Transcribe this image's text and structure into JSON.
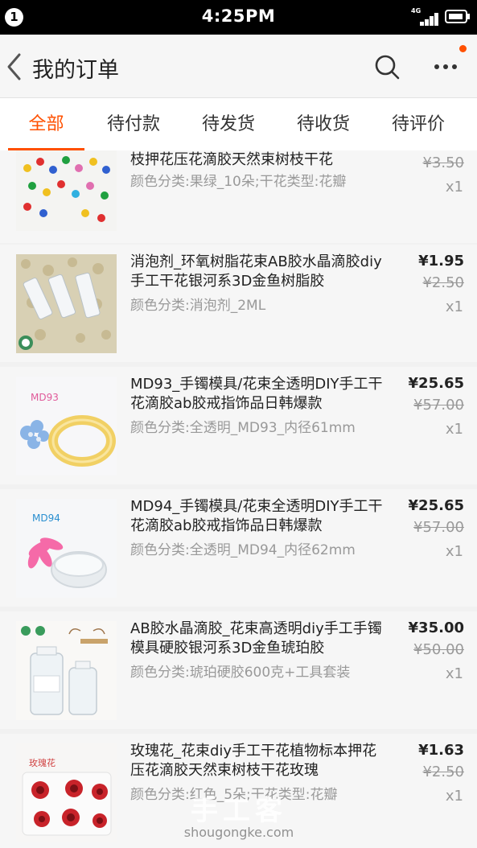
{
  "status_bar": {
    "notification_count": "1",
    "time": "4:25PM",
    "network": "4G"
  },
  "nav": {
    "title": "我的订单",
    "back_icon": "chevron-left-icon",
    "search_icon": "search-icon",
    "more_icon": "more-dots-icon"
  },
  "colors": {
    "accent": "#ff5000"
  },
  "tabs": [
    {
      "label": "全部",
      "active": true
    },
    {
      "label": "待付款",
      "active": false
    },
    {
      "label": "待发货",
      "active": false
    },
    {
      "label": "待收货",
      "active": false
    },
    {
      "label": "待评价",
      "active": false
    }
  ],
  "items": [
    {
      "title": "枝押花压花滴胶天然束树枝干花",
      "spec": "颜色分类:果绿_10朵;干花类型:花瓣",
      "price_old": "¥3.50",
      "qty": "x1"
    },
    {
      "title": "消泡剂_环氧树脂花束AB胶水晶滴胶diy手工干花银河系3D金鱼树脂胶",
      "spec": "颜色分类:消泡剂_2ML",
      "price_now": "¥1.95",
      "price_old": "¥2.50",
      "qty": "x1"
    },
    {
      "title": "MD93_手镯模具/花束全透明DIY手工干花滴胶ab胶戒指饰品日韩爆款",
      "spec": "颜色分类:全透明_MD93_内径61mm",
      "price_now": "¥25.65",
      "price_old": "¥57.00",
      "qty": "x1",
      "thumb_label": "MD93"
    },
    {
      "title": "MD94_手镯模具/花束全透明DIY手工干花滴胶ab胶戒指饰品日韩爆款",
      "spec": "颜色分类:全透明_MD94_内径62mm",
      "price_now": "¥25.65",
      "price_old": "¥57.00",
      "qty": "x1",
      "thumb_label": "MD94"
    },
    {
      "title": "AB胶水晶滴胶_花束高透明diy手工手镯模具硬胶银河系3D金鱼琥珀胶",
      "spec": "颜色分类:琥珀硬胶600克+工具套装",
      "price_now": "¥35.00",
      "price_old": "¥50.00",
      "qty": "x1"
    },
    {
      "title": "玫瑰花_花束diy手工干花植物标本押花压花滴胶天然束树枝干花玫瑰",
      "spec": "颜色分类:红色_5朵;干花类型:花瓣",
      "price_now": "¥1.63",
      "price_old": "¥2.50",
      "qty": "x1",
      "thumb_label": "玫瑰花"
    }
  ],
  "watermark": {
    "text": "手工客",
    "url": "shougongke.com"
  }
}
